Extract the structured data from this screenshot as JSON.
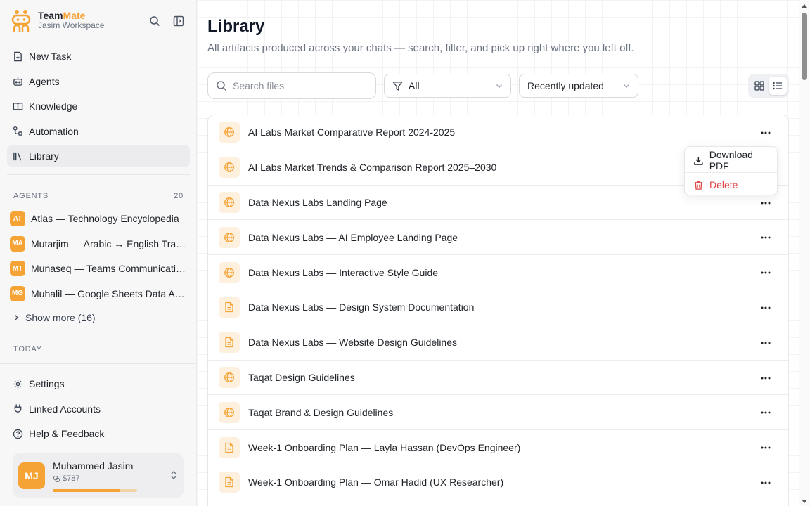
{
  "app": {
    "name_part1": "Team",
    "name_part2": "Mate",
    "workspace": "Jasim Workspace",
    "brand_color": "#f6a336"
  },
  "sidebar": {
    "nav": [
      {
        "label": "New Task",
        "icon": "new-task-icon"
      },
      {
        "label": "Agents",
        "icon": "bot-icon"
      },
      {
        "label": "Knowledge",
        "icon": "book-icon"
      },
      {
        "label": "Automation",
        "icon": "workflow-icon"
      },
      {
        "label": "Library",
        "icon": "library-icon",
        "active": true
      }
    ],
    "agents_heading": "AGENTS",
    "agents_count": "20",
    "agents": [
      {
        "initials": "AT",
        "name": "Atlas — Technology Encyclopedia"
      },
      {
        "initials": "MA",
        "name": "Mutarjim — Arabic ↔ English Translator"
      },
      {
        "initials": "MT",
        "name": "Munaseq — Teams Communication Coordinator"
      },
      {
        "initials": "MG",
        "name": "Muhalil — Google Sheets Data Analyst"
      }
    ],
    "show_more": "Show more (16)",
    "today_heading": "TODAY",
    "bottom_nav": [
      {
        "label": "Settings",
        "icon": "gear-icon"
      },
      {
        "label": "Linked Accounts",
        "icon": "plug-icon"
      },
      {
        "label": "Help & Feedback",
        "icon": "help-icon"
      }
    ],
    "user": {
      "initials": "MJ",
      "name": "Muhammed Jasim",
      "credit": "$787",
      "credit_fraction": 0.8
    }
  },
  "main": {
    "title": "Library",
    "subtitle": "All artifacts produced across your chats — search, filter, and pick up right where you left off.",
    "search_placeholder": "Search files",
    "filter_value": "All",
    "sort_value": "Recently updated",
    "view_mode": "list",
    "items": [
      {
        "title": "AI Labs Market Comparative Report 2024-2025",
        "type": "web"
      },
      {
        "title": "AI Labs Market Trends & Comparison Report 2025–2030",
        "type": "web"
      },
      {
        "title": "Data Nexus Labs Landing Page",
        "type": "web"
      },
      {
        "title": "Data Nexus Labs — AI Employee Landing Page",
        "type": "web"
      },
      {
        "title": "Data Nexus Labs — Interactive Style Guide",
        "type": "web"
      },
      {
        "title": "Data Nexus Labs — Design System Documentation",
        "type": "doc"
      },
      {
        "title": "Data Nexus Labs — Website Design Guidelines",
        "type": "doc"
      },
      {
        "title": "Taqat Design Guidelines",
        "type": "web"
      },
      {
        "title": "Taqat Brand & Design Guidelines",
        "type": "web"
      },
      {
        "title": "Week-1 Onboarding Plan — Layla Hassan (DevOps Engineer)",
        "type": "doc"
      },
      {
        "title": "Week-1 Onboarding Plan — Omar Hadid (UX Researcher)",
        "type": "doc"
      }
    ],
    "context_menu": {
      "download": "Download PDF",
      "delete": "Delete",
      "danger_color": "#e04646"
    }
  }
}
